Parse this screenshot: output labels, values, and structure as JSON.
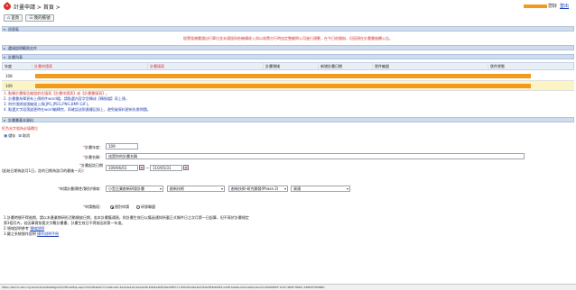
{
  "header": {
    "brand": "計畫申請 > 首頁 >",
    "user_suffix": "您好",
    "logout": "登出",
    "accent": "#f29a1a"
  },
  "tabs": [
    {
      "label": "首頁",
      "icon": "home-icon"
    },
    {
      "label": "我的帳號",
      "icon": "account-icon"
    }
  ],
  "panels": {
    "announce": "訊息區",
    "files": "選項說明範例文件",
    "list": "計畫列表",
    "detail": "計畫書基本資料"
  },
  "notice": "經費發補書請自行單位並未通過與依機構收入與以收費方行時加定整顧問公司進行規劃，在今日前開辦，但因現在計畫書後續公告。",
  "grid": {
    "headers": [
      "年度",
      "計畫申請表",
      "計畫填寫",
      "計畫領域",
      "新增計畫日期",
      "狀件編號",
      "狀件狀態"
    ],
    "rows": [
      {
        "no": "108"
      },
      {
        "no": "109"
      }
    ]
  },
  "notes": [
    {
      "text": "1. 點擊計畫報告編號前往填寫【計畫申請表】或【計畫書填寫】。",
      "tone": "red"
    },
    {
      "text": "2. 計畫書為單頁有上傳附件word檔，請點選內容字型轉成【轉換檔】再上傳。",
      "tone": "blue"
    },
    {
      "text": "3. 附件請掃描請編號上傳(JPG,JPEG,PNG,BMP,GIF)。",
      "tone": "blue"
    },
    {
      "text": "4. 點選文字段落變更時在word編輯完，再確認送財產權記錄上，避免破資料更新失敗問題。",
      "tone": "blue"
    }
  ],
  "detail": {
    "subtitle": "紅色米字號為必填欄位",
    "save": "儲存",
    "close": "取消",
    "year_label": "計畫年度：",
    "year_value": "109",
    "name_label": "計畫名稱：",
    "name_value": "這是你的計畫名稱",
    "date_label": "計畫起訖日期",
    "date_hint": "(起始日期為該月1日，訖的日期為該月的最後一天)：",
    "date_from": "109/06/01",
    "date_sep": "~",
    "date_to": "110/05/31",
    "category_label": "申請計畫/屬性/類別/領域：",
    "category_values": [
      "小型企業創新研發計畫",
      "創新技術",
      "創新技術-研究開發(Phase 2)",
      "資通"
    ],
    "stage_label": "申請階段：",
    "stage_options": [
      {
        "label": "個別申請",
        "checked": true
      },
      {
        "label": "研發聯盟",
        "checked": false
      }
    ]
  },
  "footer_notes": [
    "1.計畫時間不得逾期，請以本產業期研形活動開放日期，若本計畫獲通過，則計畫生效日以獲函通知所載正式條件日之次月第一日起算，但不表於計畫規定",
    "    第3個月內，若因事實前要文字難計畫書，計畫生效日不得前因其第一年度。",
    "2.領域說明參考",
    "3.鍵之系統操作說明"
  ],
  "footer_links": {
    "domain": "領域說明",
    "manual": "操作說明手冊"
  },
  "status_url": "https://sbirxn.sbir.org.tw/Online/WebPage/ChildFlowMap.aspx?ChildDataUrl=1e99-e4d-42da4e1e4-5e2e9d8-6d04e4f4b39e1MPV=1 8d0d5ad4e1b01f4a2f56d0d8d-e3d8-5eb9e-b5ed-&PlanGuid=2006983F-7A1F-4D0F-86DC-3386CF3009B0"
}
